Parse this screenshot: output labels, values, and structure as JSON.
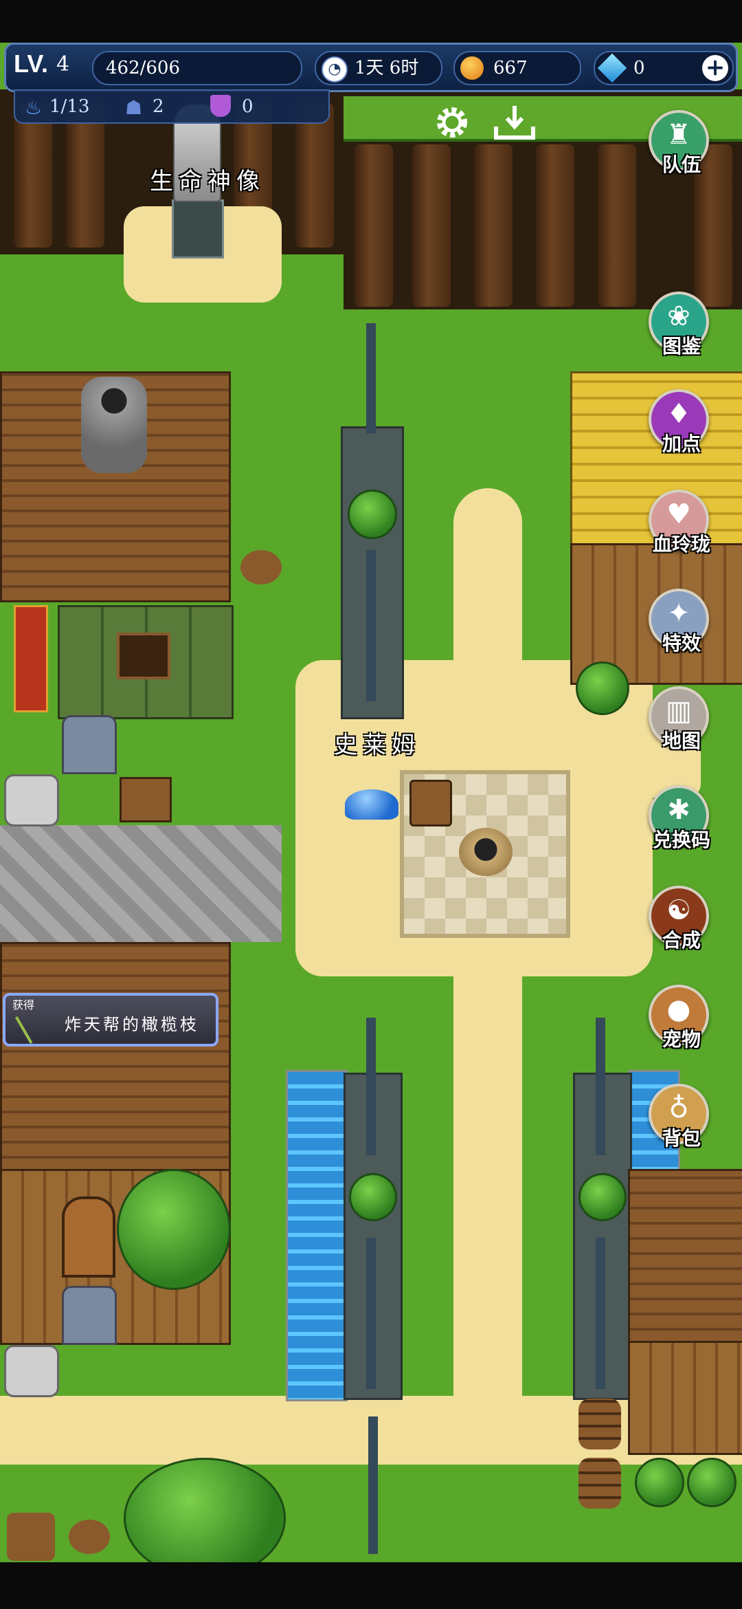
{
  "hud": {
    "level_label": "LV.",
    "level_value": "4",
    "exp": "462/606",
    "time": "1天 6时",
    "gold": "667",
    "gems": "0",
    "stat_a": "1/13",
    "stat_b": "2",
    "stat_c": "0"
  },
  "top_icons": {
    "settings": "gear-icon",
    "download": "download-icon"
  },
  "side_menu": [
    {
      "label": "队伍",
      "icon": "team-icon",
      "color": "#3aa06a"
    },
    {
      "label": "图鉴",
      "icon": "paw-icon",
      "color": "#2aa58a"
    },
    {
      "label": "加点",
      "icon": "flame-icon",
      "color": "#9a3ab8"
    },
    {
      "label": "血玲珑",
      "icon": "heart-icon",
      "color": "#d79a9a"
    },
    {
      "label": "特效",
      "icon": "wand-icon",
      "color": "#8aa0c0"
    },
    {
      "label": "地图",
      "icon": "map-icon",
      "color": "#b0a8a0"
    },
    {
      "label": "兑换码",
      "icon": "code-icon",
      "color": "#3a9a6a"
    },
    {
      "label": "合成",
      "icon": "yinyang-icon",
      "color": "#8a3a1a"
    },
    {
      "label": "宠物",
      "icon": "pig-icon",
      "color": "#c07a3a"
    },
    {
      "label": "背包",
      "icon": "bag-icon",
      "color": "#d0a050"
    }
  ],
  "map_labels": {
    "statue": "生命神像",
    "slime": "史莱姆"
  },
  "notification": {
    "tag": "获得",
    "text": "炸天帮的橄榄枝"
  }
}
